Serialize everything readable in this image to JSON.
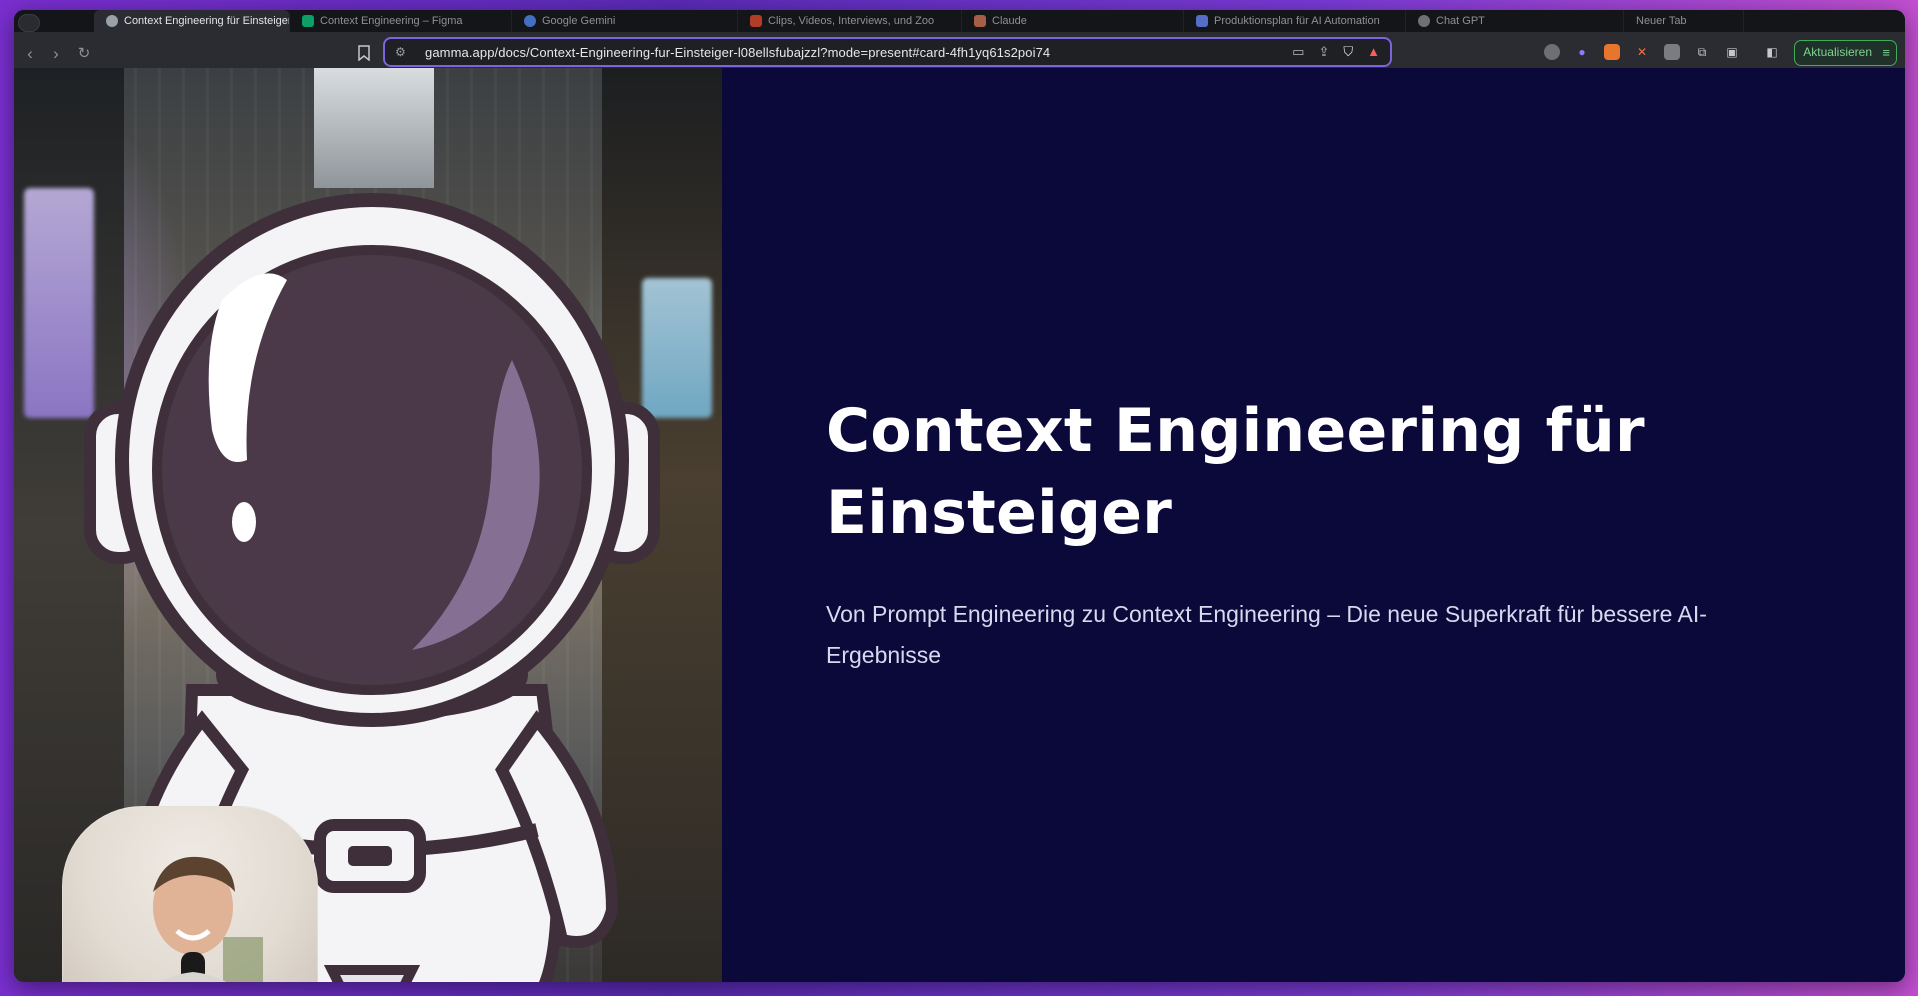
{
  "browser": {
    "tabs": [
      {
        "label": "Context Engineering für Einsteiger",
        "active": true,
        "color": "#9aa0a6"
      },
      {
        "label": "Context Engineering – Figma",
        "active": false,
        "color": "#0acf83"
      },
      {
        "label": "Google Gemini",
        "active": false,
        "color": "#4f8ff7"
      },
      {
        "label": "Clips, Videos, Interviews, und Zoo",
        "active": false,
        "color": "#e84a2e"
      },
      {
        "label": "Claude",
        "active": false,
        "color": "#d97757"
      },
      {
        "label": "Produktionsplan für AI Automation",
        "active": false,
        "color": "#6b8cff"
      },
      {
        "label": "Chat GPT",
        "active": false,
        "color": "#8e8e93"
      },
      {
        "label": "Neuer Tab",
        "active": false,
        "color": "#8e8e93"
      }
    ],
    "url": "gamma.app/docs/Context-Engineering-fur-Einsteiger-l08ellsfubajzzl?mode=present#card-4fh1yq61s2poi74",
    "update_label": "Aktualisieren"
  },
  "slide": {
    "title_line1": "Context Engineering für",
    "title_line2": "Einsteiger",
    "subtitle_line1": "Von Prompt Engineering zu Context Engineering – Die neue Superkraft für bessere AI-",
    "subtitle_line2": "Ergebnisse"
  },
  "colors": {
    "slide_background": "#0b083a",
    "accent_border": "#7d63e0",
    "update_green": "#3fae58"
  }
}
